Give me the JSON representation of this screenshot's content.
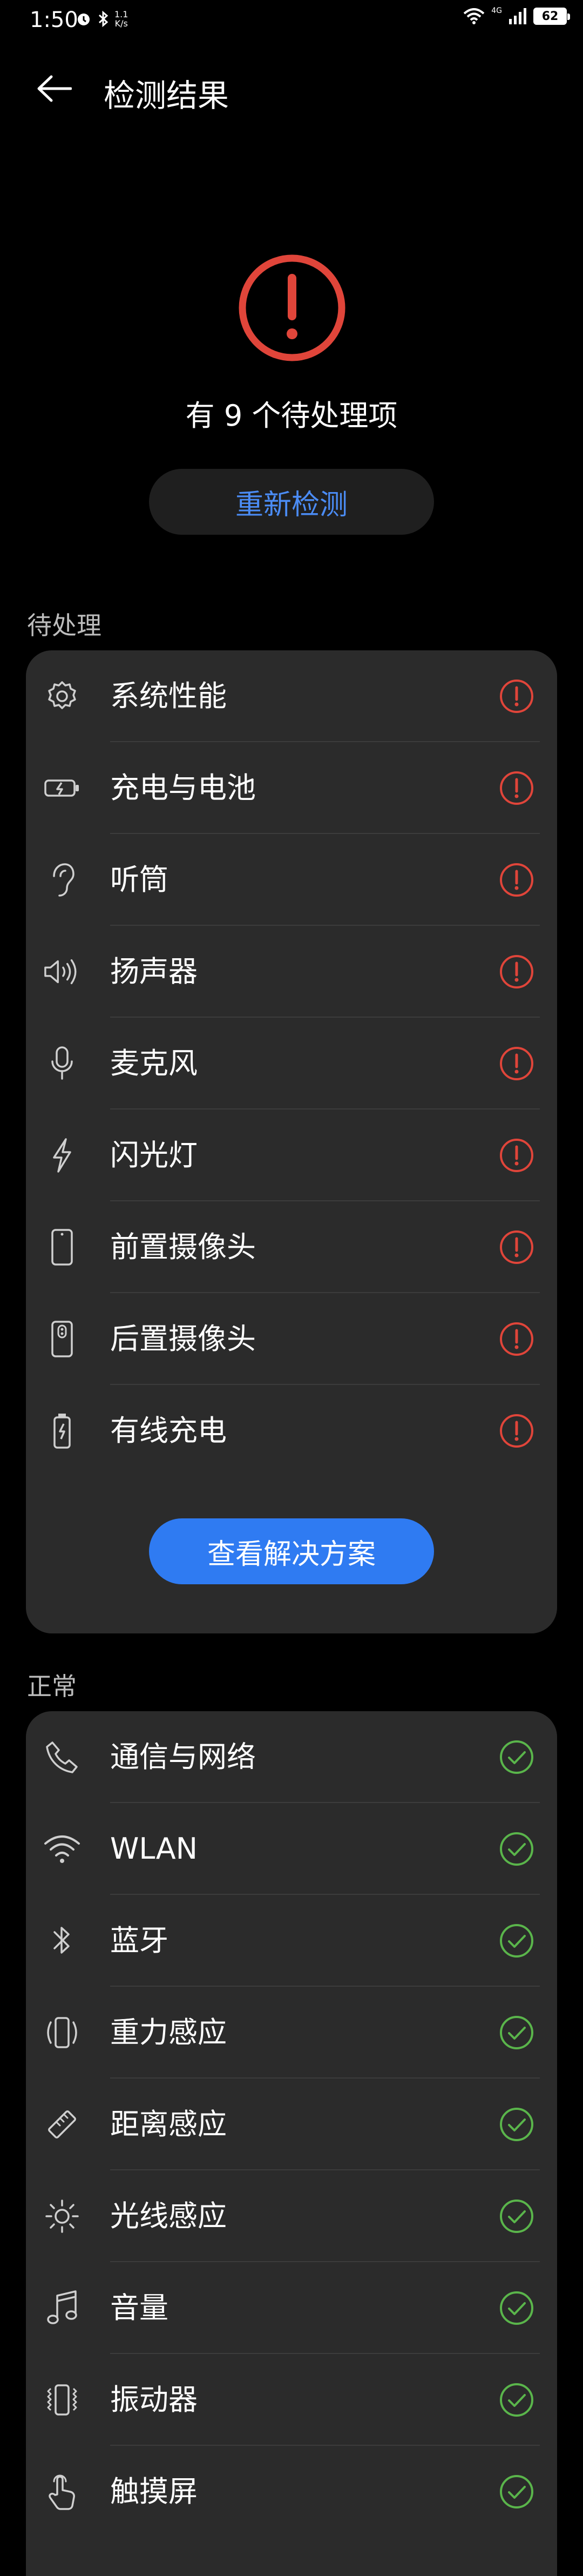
{
  "status_bar": {
    "time": "1:50",
    "net_speed_value": "1.1",
    "net_speed_unit": "K/s",
    "signal_label": "4G",
    "battery": "62"
  },
  "header": {
    "title": "检测结果"
  },
  "summary": {
    "text": "有 9 个待处理项",
    "recheck_label": "重新检测"
  },
  "pending": {
    "title": "待处理",
    "items": [
      {
        "label": "系统性能",
        "icon": "gear-icon"
      },
      {
        "label": "充电与电池",
        "icon": "battery-icon"
      },
      {
        "label": "听筒",
        "icon": "ear-icon"
      },
      {
        "label": "扬声器",
        "icon": "speaker-icon"
      },
      {
        "label": "麦克风",
        "icon": "microphone-icon"
      },
      {
        "label": "闪光灯",
        "icon": "flash-icon"
      },
      {
        "label": "前置摄像头",
        "icon": "front-camera-icon"
      },
      {
        "label": "后置摄像头",
        "icon": "rear-camera-icon"
      },
      {
        "label": "有线充电",
        "icon": "wired-charging-icon"
      }
    ],
    "solution_label": "查看解决方案"
  },
  "normal": {
    "title": "正常",
    "items": [
      {
        "label": "通信与网络",
        "icon": "phone-icon"
      },
      {
        "label": "WLAN",
        "icon": "wifi-icon"
      },
      {
        "label": "蓝牙",
        "icon": "bluetooth-icon"
      },
      {
        "label": "重力感应",
        "icon": "gravity-sensor-icon"
      },
      {
        "label": "距离感应",
        "icon": "ruler-icon"
      },
      {
        "label": "光线感应",
        "icon": "sun-icon"
      },
      {
        "label": "音量",
        "icon": "music-note-icon"
      },
      {
        "label": "振动器",
        "icon": "vibration-icon"
      },
      {
        "label": "触摸屏",
        "icon": "touch-icon"
      }
    ]
  },
  "colors": {
    "background": "#000000",
    "card": "#2b2b2b",
    "alert_red": "#e0453a",
    "ok_green": "#5ab54b",
    "accent_blue": "#2f7bf2",
    "link_blue": "#4b8cf5"
  }
}
